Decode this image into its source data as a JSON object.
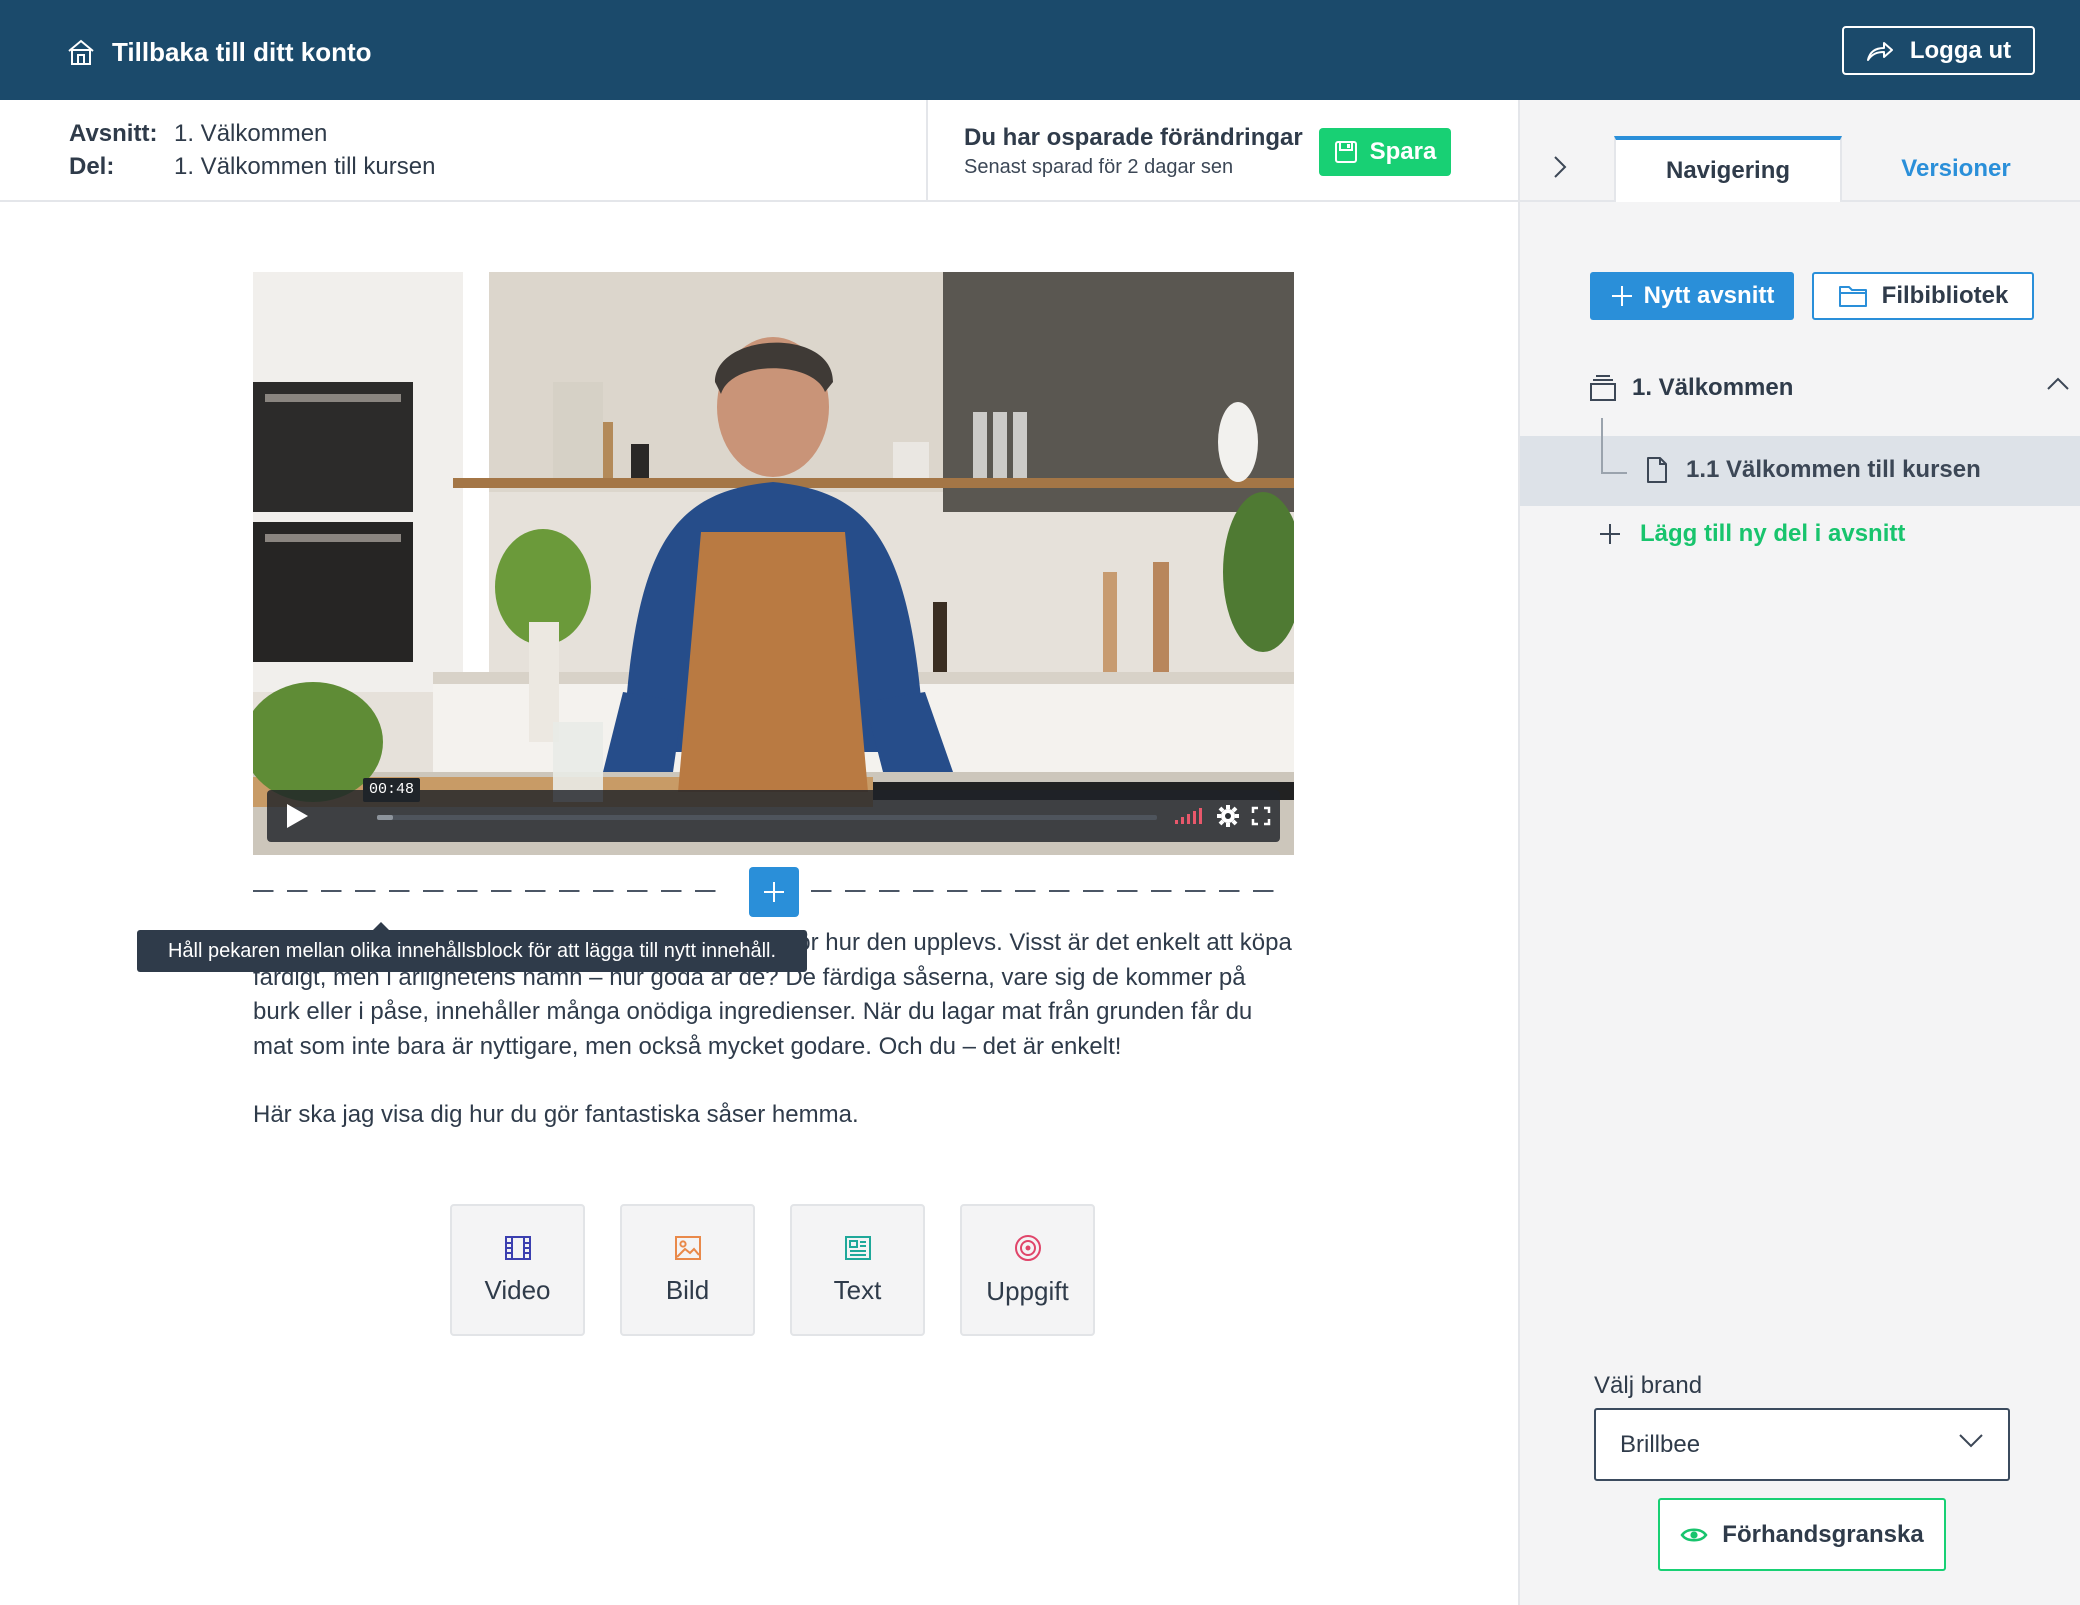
{
  "topbar": {
    "back_label": "Tillbaka till ditt konto",
    "logout_label": "Logga ut",
    "background": "#1b4a6b"
  },
  "crumbs": {
    "section_key": "Avsnitt:",
    "section_value": "1. Välkommen",
    "part_key": "Del:",
    "part_value": "1. Välkommen till kursen"
  },
  "save": {
    "title": "Du har osparade förändringar",
    "subtitle": "Senast sparad för 2 dagar sen",
    "button_label": "Spara",
    "color": "#18d074"
  },
  "sidebar": {
    "tabs": [
      {
        "label": "Navigering",
        "active": true
      },
      {
        "label": "Versioner",
        "active": false
      }
    ],
    "new_section_label": "Nytt avsnitt",
    "file_library_label": "Filbibliotek",
    "sections": [
      {
        "title": "1. Välkommen",
        "expanded": true,
        "parts": [
          {
            "title": "1.1 Välkommen till kursen",
            "selected": true
          }
        ]
      }
    ],
    "add_part_label": "Lägg till ny del i avsnitt",
    "brand_label": "Välj brand",
    "brand_value": "Brillbee",
    "preview_label": "Förhandsgranska",
    "accent": "#2a8fd9"
  },
  "video": {
    "timecode": "00:48",
    "progress": 0.02,
    "icons": [
      "play-icon",
      "volume-icon",
      "gear-icon",
      "fullscreen-icon"
    ]
  },
  "editor": {
    "tooltip": "Håll pekaren mellan olika innehållsblock för att lägga till nytt innehåll.",
    "paragraph_1": "Sås kan verkligen lyfta en måltid och göra skillnad för hur den upplevs. Visst är det enkelt att köpa färdigt, men i ärlighetens namn – hur goda är de? De färdiga såserna, vare sig de kommer på burk eller i påse, innehåller många onödiga ingredienser. När du lagar mat från grunden får du mat som inte bara är nyttigare, men också mycket godare. Och du – det är enkelt!",
    "paragraph_2": "Här ska jag visa dig hur du gör fantastiska såser hemma.",
    "blocks": [
      {
        "label": "Video",
        "icon": "film-icon",
        "color": "#3b3fb0"
      },
      {
        "label": "Bild",
        "icon": "image-icon",
        "color": "#e9894a"
      },
      {
        "label": "Text",
        "icon": "text-block-icon",
        "color": "#1fa89a"
      },
      {
        "label": "Uppgift",
        "icon": "target-icon",
        "color": "#e0456a"
      }
    ]
  }
}
